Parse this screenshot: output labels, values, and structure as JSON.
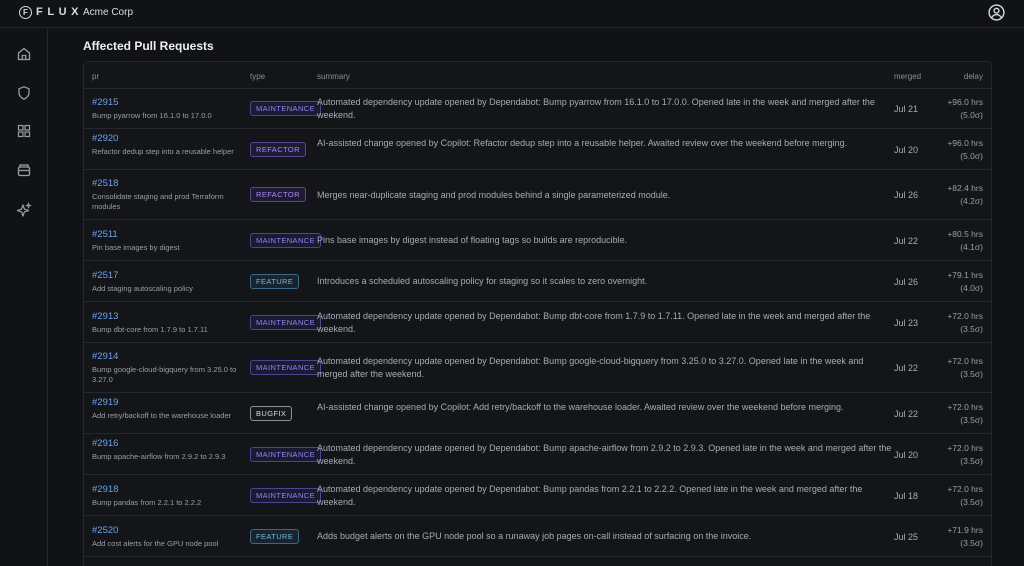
{
  "app": {
    "logo_letter": "F",
    "logo_text": "FLUX",
    "org_name": "Acme Corp"
  },
  "icons": {
    "logo": "flux-logo-icon",
    "profile": "user-circle-icon",
    "nav": [
      "home-icon",
      "shield-icon",
      "grid-icon",
      "archive-icon",
      "sparkles-icon"
    ]
  },
  "section_title": "Affected Pull Requests",
  "table": {
    "headers": {
      "pr": "pr",
      "type": "type",
      "summary": "summary",
      "merged": "merged",
      "delay": "delay"
    },
    "rows": [
      {
        "pr": "#2915",
        "title": "Bump pyarrow from 16.1.0 to 17.0.0",
        "type": "MAINTENANCE",
        "summary": "Automated dependency update opened by Dependabot: Bump pyarrow from 16.1.0 to 17.0.0. Opened late in the week and merged after the weekend.",
        "merged": "Jul 21",
        "delay": "+96.0 hrs",
        "delay_sigma": "(5.0σ)"
      },
      {
        "pr": "#2920",
        "title": "Refactor dedup step into a reusable helper",
        "type": "REFACTOR",
        "summary": "AI-assisted change opened by Copilot: Refactor dedup step into a reusable helper. Awaited review over the weekend before merging.",
        "merged": "Jul 20",
        "delay": "+96.0 hrs",
        "delay_sigma": "(5.0σ)"
      },
      {
        "pr": "#2518",
        "title": "Consolidate staging and prod Terraform modules",
        "type": "REFACTOR",
        "summary": "Merges near-duplicate staging and prod modules behind a single parameterized module.",
        "merged": "Jul 26",
        "delay": "+82.4 hrs",
        "delay_sigma": "(4.2σ)"
      },
      {
        "pr": "#2511",
        "title": "Pin base images by digest",
        "type": "MAINTENANCE",
        "summary": "Pins base images by digest instead of floating tags so builds are reproducible.",
        "merged": "Jul 22",
        "delay": "+80.5 hrs",
        "delay_sigma": "(4.1σ)"
      },
      {
        "pr": "#2517",
        "title": "Add staging autoscaling policy",
        "type": "FEATURE",
        "summary": "Introduces a scheduled autoscaling policy for staging so it scales to zero overnight.",
        "merged": "Jul 26",
        "delay": "+79.1 hrs",
        "delay_sigma": "(4.0σ)"
      },
      {
        "pr": "#2913",
        "title": "Bump dbt-core from 1.7.9 to 1.7.11",
        "type": "MAINTENANCE",
        "summary": "Automated dependency update opened by Dependabot: Bump dbt-core from 1.7.9 to 1.7.11. Opened late in the week and merged after the weekend.",
        "merged": "Jul 23",
        "delay": "+72.0 hrs",
        "delay_sigma": "(3.5σ)"
      },
      {
        "pr": "#2914",
        "title": "Bump google-cloud-bigquery from 3.25.0 to 3.27.0",
        "type": "MAINTENANCE",
        "summary": "Automated dependency update opened by Dependabot: Bump google-cloud-bigquery from 3.25.0 to 3.27.0. Opened late in the week and merged after the weekend.",
        "merged": "Jul 22",
        "delay": "+72.0 hrs",
        "delay_sigma": "(3.5σ)"
      },
      {
        "pr": "#2919",
        "title": "Add retry/backoff to the warehouse loader",
        "type": "BUGFIX",
        "summary": "AI-assisted change opened by Copilot: Add retry/backoff to the warehouse loader. Awaited review over the weekend before merging.",
        "merged": "Jul 22",
        "delay": "+72.0 hrs",
        "delay_sigma": "(3.5σ)"
      },
      {
        "pr": "#2916",
        "title": "Bump apache-airflow from 2.9.2 to 2.9.3",
        "type": "MAINTENANCE",
        "summary": "Automated dependency update opened by Dependabot: Bump apache-airflow from 2.9.2 to 2.9.3. Opened late in the week and merged after the weekend.",
        "merged": "Jul 20",
        "delay": "+72.0 hrs",
        "delay_sigma": "(3.5σ)"
      },
      {
        "pr": "#2918",
        "title": "Bump pandas from 2.2.1 to 2.2.2",
        "type": "MAINTENANCE",
        "summary": "Automated dependency update opened by Dependabot: Bump pandas from 2.2.1 to 2.2.2. Opened late in the week and merged after the weekend.",
        "merged": "Jul 18",
        "delay": "+72.0 hrs",
        "delay_sigma": "(3.5σ)"
      },
      {
        "pr": "#2520",
        "title": "Add cost alerts for the GPU node pool",
        "type": "FEATURE",
        "summary": "Adds budget alerts on the GPU node pool so a runaway job pages on-call instead of surfacing on the invoice.",
        "merged": "Jul 25",
        "delay": "+71.9 hrs",
        "delay_sigma": "(3.5σ)"
      }
    ]
  }
}
